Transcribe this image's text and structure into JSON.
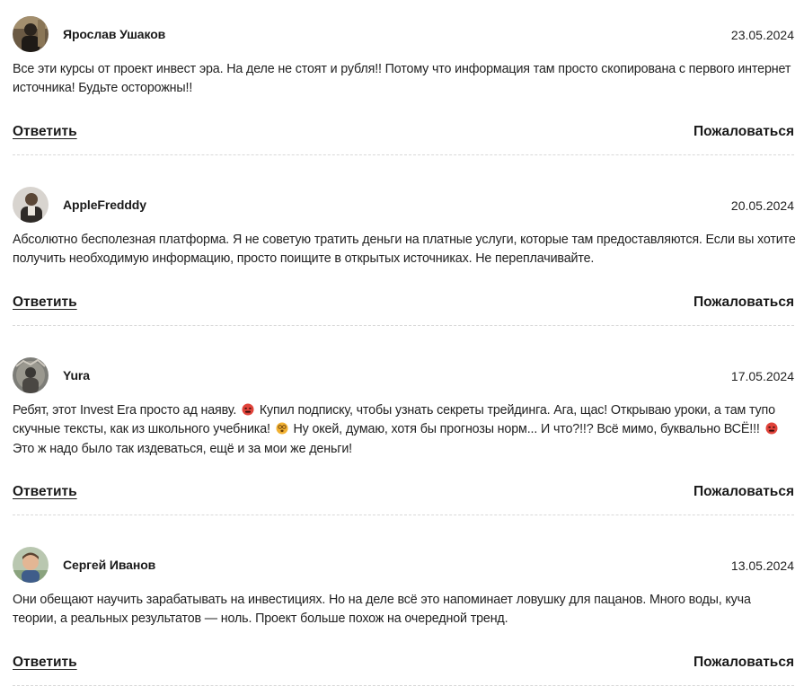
{
  "comments": [
    {
      "author": "Ярослав Ушаков",
      "date": "23.05.2024",
      "text": "Все эти курсы от проект инвест эра. На деле не стоят и рубля!! Потому что информация там просто скопирована с первого интернет источника! Будьте осторожны!!",
      "reply_label": "Ответить",
      "report_label": "Пожаловаться"
    },
    {
      "author": "AppleFredddy",
      "date": "20.05.2024",
      "text": "Абсолютно бесполезная платформа. Я не советую тратить деньги на платные услуги, которые там предоставляются. Если вы хотите получить необходимую информацию, просто поищите в открытых источниках. Не переплачивайте.",
      "reply_label": "Ответить",
      "report_label": "Пожаловаться"
    },
    {
      "author": "Yura",
      "date": "17.05.2024",
      "text_part_1": "Ребят, этот Invest Era просто ад наяву.",
      "text_part_2": "Купил подписку, чтобы узнать секреты трейдинга. Ага, щас! Открываю уроки, а там тупо скучные тексты, как из школьного учебника!",
      "text_part_3": "Ну окей, думаю, хотя бы прогнозы норм... И что?!!? Всё мимо, буквально ВСЁ!!!",
      "text_part_4": "Это ж надо было так издеваться, ещё и за мои же деньги!",
      "emoji_1": "angry-face-emoji",
      "emoji_2": "dizzy-face-emoji",
      "emoji_3": "angry-face-emoji",
      "reply_label": "Ответить",
      "report_label": "Пожаловаться"
    },
    {
      "author": "Сергей Иванов",
      "date": "13.05.2024",
      "text": "Они обещают научить зарабатывать на инвестициях. Но на деле всё это напоминает ловушку для пацанов. Много воды, куча теории, а реальных результатов — ноль. Проект больше похож на очередной тренд.",
      "reply_label": "Ответить",
      "report_label": "Пожаловаться"
    }
  ]
}
